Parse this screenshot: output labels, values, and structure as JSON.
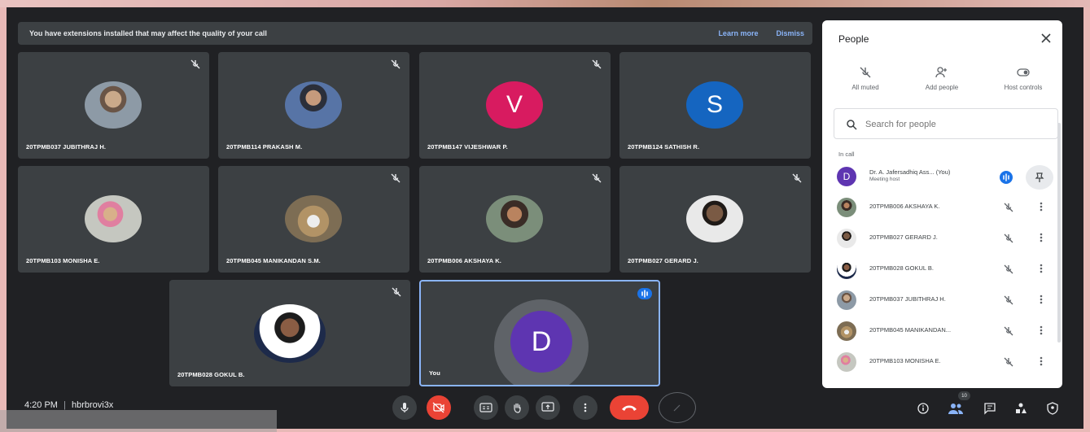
{
  "banner": {
    "message": "You have extensions installed that may affect the quality of your call",
    "learn_more": "Learn more",
    "dismiss": "Dismiss"
  },
  "tiles": [
    {
      "name": "20TPMB037 JUBITHRAJ H."
    },
    {
      "name": "20TPMB114 PRAKASH M."
    },
    {
      "name": "20TPMB147 VIJESHWAR P.",
      "letter": "V",
      "color": "#d81b60"
    },
    {
      "name": "20TPMB124 SATHISH R.",
      "letter": "S",
      "color": "#1565c0"
    },
    {
      "name": "20TPMB103 MONISHA E."
    },
    {
      "name": "20TPMB045 MANIKANDAN S.M."
    },
    {
      "name": "20TPMB006 AKSHAYA K."
    },
    {
      "name": "20TPMB027 GERARD J."
    },
    {
      "name": "20TPMB028 GOKUL B."
    },
    {
      "name": "You",
      "letter": "D",
      "color": "#5e35b1"
    }
  ],
  "panel": {
    "title": "People",
    "actions": [
      "All muted",
      "Add people",
      "Host controls"
    ],
    "search_placeholder": "Search for people",
    "section": "In call",
    "host": {
      "name": "Dr. A. Jafersadhiq Ass...",
      "tag": "(You)",
      "role": "Meeting host",
      "letter": "D",
      "color": "#5e35b1"
    },
    "people": [
      "20TPMB006 AKSHAYA K.",
      "20TPMB027 GERARD J.",
      "20TPMB028 GOKUL B.",
      "20TPMB037 JUBITHRAJ H.",
      "20TPMB045 MANIKANDAN...",
      "20TPMB103 MONISHA E."
    ]
  },
  "bottom": {
    "time": "4:20 PM",
    "separator": "|",
    "meeting_code": "hbrbrovi3x",
    "participant_count": "10"
  },
  "colors": {
    "background": "#202124",
    "tile": "#3c4043",
    "accent": "#8ab4f8",
    "danger": "#ea4335"
  }
}
